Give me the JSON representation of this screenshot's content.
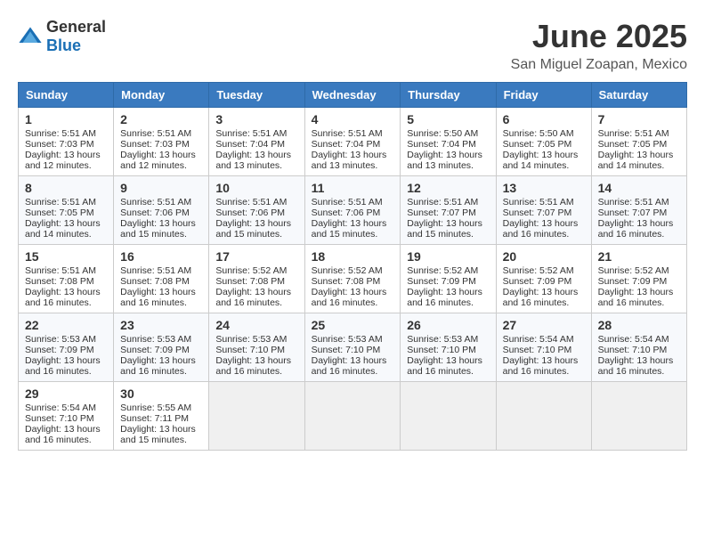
{
  "header": {
    "logo_general": "General",
    "logo_blue": "Blue",
    "title": "June 2025",
    "location": "San Miguel Zoapan, Mexico"
  },
  "days_of_week": [
    "Sunday",
    "Monday",
    "Tuesday",
    "Wednesday",
    "Thursday",
    "Friday",
    "Saturday"
  ],
  "weeks": [
    [
      {
        "day": "1",
        "lines": [
          "Sunrise: 5:51 AM",
          "Sunset: 7:03 PM",
          "Daylight: 13 hours",
          "and 12 minutes."
        ]
      },
      {
        "day": "2",
        "lines": [
          "Sunrise: 5:51 AM",
          "Sunset: 7:03 PM",
          "Daylight: 13 hours",
          "and 12 minutes."
        ]
      },
      {
        "day": "3",
        "lines": [
          "Sunrise: 5:51 AM",
          "Sunset: 7:04 PM",
          "Daylight: 13 hours",
          "and 13 minutes."
        ]
      },
      {
        "day": "4",
        "lines": [
          "Sunrise: 5:51 AM",
          "Sunset: 7:04 PM",
          "Daylight: 13 hours",
          "and 13 minutes."
        ]
      },
      {
        "day": "5",
        "lines": [
          "Sunrise: 5:50 AM",
          "Sunset: 7:04 PM",
          "Daylight: 13 hours",
          "and 13 minutes."
        ]
      },
      {
        "day": "6",
        "lines": [
          "Sunrise: 5:50 AM",
          "Sunset: 7:05 PM",
          "Daylight: 13 hours",
          "and 14 minutes."
        ]
      },
      {
        "day": "7",
        "lines": [
          "Sunrise: 5:51 AM",
          "Sunset: 7:05 PM",
          "Daylight: 13 hours",
          "and 14 minutes."
        ]
      }
    ],
    [
      {
        "day": "8",
        "lines": [
          "Sunrise: 5:51 AM",
          "Sunset: 7:05 PM",
          "Daylight: 13 hours",
          "and 14 minutes."
        ]
      },
      {
        "day": "9",
        "lines": [
          "Sunrise: 5:51 AM",
          "Sunset: 7:06 PM",
          "Daylight: 13 hours",
          "and 15 minutes."
        ]
      },
      {
        "day": "10",
        "lines": [
          "Sunrise: 5:51 AM",
          "Sunset: 7:06 PM",
          "Daylight: 13 hours",
          "and 15 minutes."
        ]
      },
      {
        "day": "11",
        "lines": [
          "Sunrise: 5:51 AM",
          "Sunset: 7:06 PM",
          "Daylight: 13 hours",
          "and 15 minutes."
        ]
      },
      {
        "day": "12",
        "lines": [
          "Sunrise: 5:51 AM",
          "Sunset: 7:07 PM",
          "Daylight: 13 hours",
          "and 15 minutes."
        ]
      },
      {
        "day": "13",
        "lines": [
          "Sunrise: 5:51 AM",
          "Sunset: 7:07 PM",
          "Daylight: 13 hours",
          "and 16 minutes."
        ]
      },
      {
        "day": "14",
        "lines": [
          "Sunrise: 5:51 AM",
          "Sunset: 7:07 PM",
          "Daylight: 13 hours",
          "and 16 minutes."
        ]
      }
    ],
    [
      {
        "day": "15",
        "lines": [
          "Sunrise: 5:51 AM",
          "Sunset: 7:08 PM",
          "Daylight: 13 hours",
          "and 16 minutes."
        ]
      },
      {
        "day": "16",
        "lines": [
          "Sunrise: 5:51 AM",
          "Sunset: 7:08 PM",
          "Daylight: 13 hours",
          "and 16 minutes."
        ]
      },
      {
        "day": "17",
        "lines": [
          "Sunrise: 5:52 AM",
          "Sunset: 7:08 PM",
          "Daylight: 13 hours",
          "and 16 minutes."
        ]
      },
      {
        "day": "18",
        "lines": [
          "Sunrise: 5:52 AM",
          "Sunset: 7:08 PM",
          "Daylight: 13 hours",
          "and 16 minutes."
        ]
      },
      {
        "day": "19",
        "lines": [
          "Sunrise: 5:52 AM",
          "Sunset: 7:09 PM",
          "Daylight: 13 hours",
          "and 16 minutes."
        ]
      },
      {
        "day": "20",
        "lines": [
          "Sunrise: 5:52 AM",
          "Sunset: 7:09 PM",
          "Daylight: 13 hours",
          "and 16 minutes."
        ]
      },
      {
        "day": "21",
        "lines": [
          "Sunrise: 5:52 AM",
          "Sunset: 7:09 PM",
          "Daylight: 13 hours",
          "and 16 minutes."
        ]
      }
    ],
    [
      {
        "day": "22",
        "lines": [
          "Sunrise: 5:53 AM",
          "Sunset: 7:09 PM",
          "Daylight: 13 hours",
          "and 16 minutes."
        ]
      },
      {
        "day": "23",
        "lines": [
          "Sunrise: 5:53 AM",
          "Sunset: 7:09 PM",
          "Daylight: 13 hours",
          "and 16 minutes."
        ]
      },
      {
        "day": "24",
        "lines": [
          "Sunrise: 5:53 AM",
          "Sunset: 7:10 PM",
          "Daylight: 13 hours",
          "and 16 minutes."
        ]
      },
      {
        "day": "25",
        "lines": [
          "Sunrise: 5:53 AM",
          "Sunset: 7:10 PM",
          "Daylight: 13 hours",
          "and 16 minutes."
        ]
      },
      {
        "day": "26",
        "lines": [
          "Sunrise: 5:53 AM",
          "Sunset: 7:10 PM",
          "Daylight: 13 hours",
          "and 16 minutes."
        ]
      },
      {
        "day": "27",
        "lines": [
          "Sunrise: 5:54 AM",
          "Sunset: 7:10 PM",
          "Daylight: 13 hours",
          "and 16 minutes."
        ]
      },
      {
        "day": "28",
        "lines": [
          "Sunrise: 5:54 AM",
          "Sunset: 7:10 PM",
          "Daylight: 13 hours",
          "and 16 minutes."
        ]
      }
    ],
    [
      {
        "day": "29",
        "lines": [
          "Sunrise: 5:54 AM",
          "Sunset: 7:10 PM",
          "Daylight: 13 hours",
          "and 16 minutes."
        ]
      },
      {
        "day": "30",
        "lines": [
          "Sunrise: 5:55 AM",
          "Sunset: 7:11 PM",
          "Daylight: 13 hours",
          "and 15 minutes."
        ]
      },
      null,
      null,
      null,
      null,
      null
    ]
  ]
}
